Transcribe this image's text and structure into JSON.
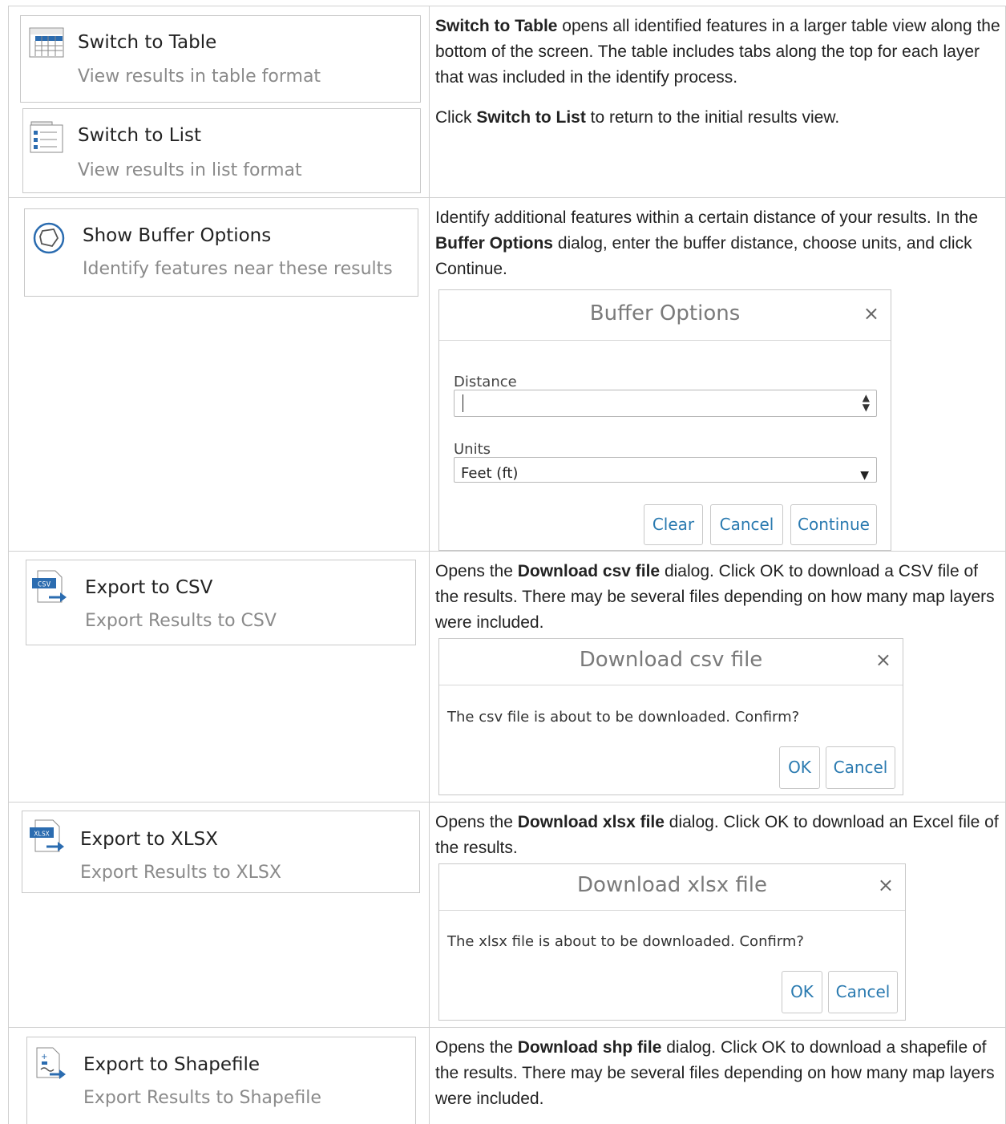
{
  "rows": [
    {
      "cards": [
        {
          "title": "Switch to Table",
          "subtitle": "View results in table format",
          "icon": "table-icon"
        },
        {
          "title": "Switch to List",
          "subtitle": "View results in list format",
          "icon": "list-icon"
        }
      ],
      "p1_b": "Switch to Table",
      "p1_t": " opens all identified features in a larger table view along the bottom of the screen. The table includes tabs along the top for each layer that was included in the identify process.",
      "p2_a": "Click ",
      "p2_b": "Switch to List",
      "p2_c": " to return to the initial results view."
    },
    {
      "card": {
        "title": "Show Buffer Options",
        "subtitle": "Identify features near these results",
        "icon": "buffer-icon"
      },
      "p_a": "Identify additional features within a certain distance of your results. In the ",
      "p_b": "Buffer Options",
      "p_c": " dialog, enter the buffer distance, choose units, and click Continue.",
      "dialog": {
        "title": "Buffer Options",
        "close": "×",
        "distance_label": "Distance",
        "distance_value": "",
        "units_label": "Units",
        "units_value": "Feet (ft)",
        "buttons": [
          "Clear",
          "Cancel",
          "Continue"
        ]
      }
    },
    {
      "card": {
        "title": "Export to CSV",
        "subtitle": "Export Results to CSV",
        "icon": "csv-export-icon"
      },
      "p_a": "Opens the ",
      "p_b": "Download csv file",
      "p_c": " dialog. Click OK to download a CSV file of the results. There may be several files depending on how many map layers were included.",
      "dialog": {
        "title": "Download csv file",
        "close": "×",
        "message": "The csv file is about to be downloaded. Confirm?",
        "buttons": [
          "OK",
          "Cancel"
        ]
      }
    },
    {
      "card": {
        "title": "Export to XLSX",
        "subtitle": "Export Results to XLSX",
        "icon": "xlsx-export-icon"
      },
      "p_a": "Opens the ",
      "p_b": "Download xlsx file",
      "p_c": " dialog. Click OK to download an Excel file of the results.",
      "dialog": {
        "title": "Download xlsx file",
        "close": "×",
        "message": "The xlsx file is about to be downloaded. Confirm?",
        "buttons": [
          "OK",
          "Cancel"
        ]
      }
    },
    {
      "card": {
        "title": "Export to Shapefile",
        "subtitle": "Export Results to Shapefile",
        "icon": "shapefile-export-icon"
      },
      "p_a": "Opens the ",
      "p_b": "Download shp file",
      "p_c": " dialog. Click OK to download a shapefile of the results. There may be several files depending on how many map layers were included."
    }
  ]
}
